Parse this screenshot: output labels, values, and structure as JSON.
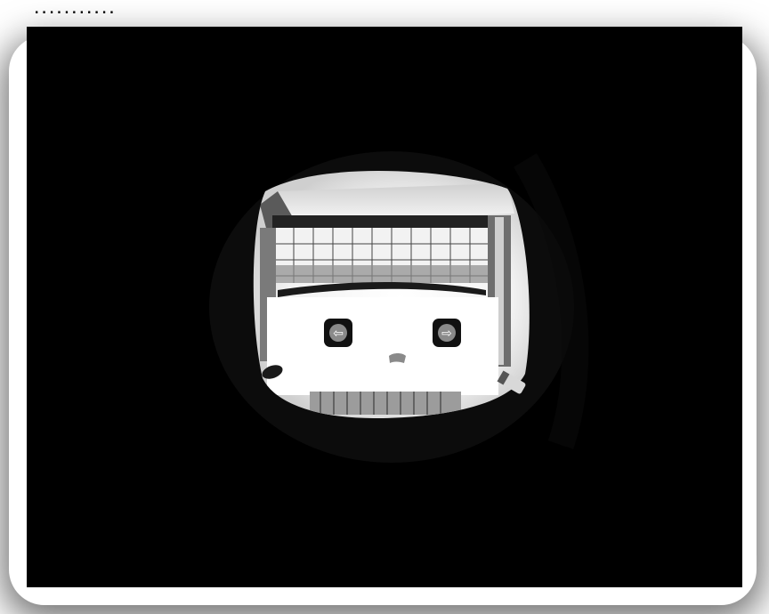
{
  "header": {
    "dots": "..........."
  },
  "scene": {
    "left_window_symbol": "⇦",
    "right_window_symbol": "⇨"
  }
}
